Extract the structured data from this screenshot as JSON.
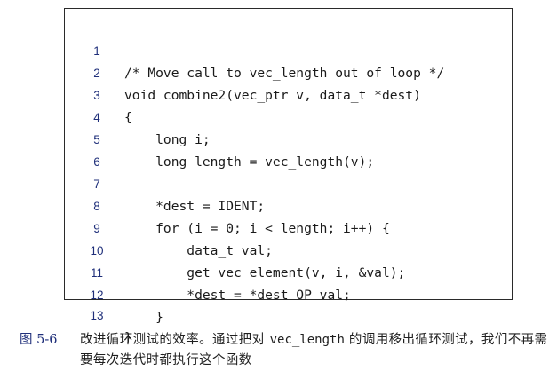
{
  "code_listing": {
    "lines": [
      {
        "num": "1",
        "text": "/* Move call to vec_length out of loop */"
      },
      {
        "num": "2",
        "text": "void combine2(vec_ptr v, data_t *dest)"
      },
      {
        "num": "3",
        "text": "{"
      },
      {
        "num": "4",
        "text": "    long i;"
      },
      {
        "num": "5",
        "text": "    long length = vec_length(v);"
      },
      {
        "num": "6",
        "text": ""
      },
      {
        "num": "7",
        "text": "    *dest = IDENT;"
      },
      {
        "num": "8",
        "text": "    for (i = 0; i < length; i++) {"
      },
      {
        "num": "9",
        "text": "        data_t val;"
      },
      {
        "num": "10",
        "text": "        get_vec_element(v, i, &val);"
      },
      {
        "num": "11",
        "text": "        *dest = *dest OP val;"
      },
      {
        "num": "12",
        "text": "    }"
      },
      {
        "num": "13",
        "text": "}"
      }
    ]
  },
  "caption": {
    "label": "图 5-6",
    "text_before": "改进循环测试的效率。通过把对 ",
    "code_term": "vec_length",
    "text_after": " 的调用移出循环测试，我们不再需要每次迭代时都执行这个函数"
  }
}
